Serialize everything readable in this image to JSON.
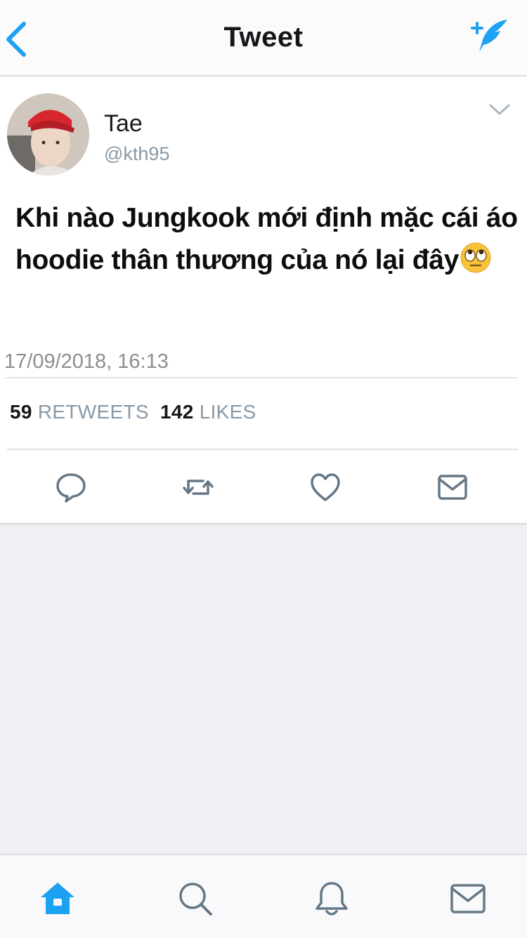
{
  "header": {
    "title": "Tweet",
    "back_icon": "chevron-left-icon",
    "compose_icon": "compose-feather-icon"
  },
  "tweet": {
    "user": {
      "name": "Tae",
      "handle": "@kth95"
    },
    "text": "Khi nào Jungkook mới định mặc cái áo hoodie thân thương của nó lại đây",
    "emoji": "rolling-eyes-emoji",
    "timestamp": "17/09/2018, 16:13",
    "stats": {
      "retweets_count": "59",
      "retweets_label": "RETWEETS",
      "likes_count": "142",
      "likes_label": "LIKES"
    },
    "actions": [
      "reply-icon",
      "retweet-icon",
      "like-icon",
      "message-icon"
    ]
  },
  "tabbar": {
    "tabs": [
      "home-icon",
      "search-icon",
      "notifications-icon",
      "messages-icon"
    ]
  },
  "colors": {
    "accent": "#1da1f2",
    "icon_gray": "#657786",
    "background": "#efeff4"
  }
}
